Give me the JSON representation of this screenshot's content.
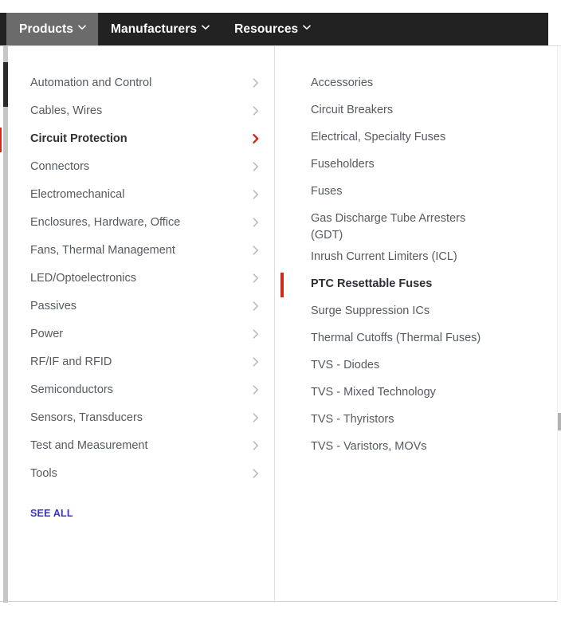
{
  "navbar": {
    "items": [
      {
        "label": "Products",
        "caret": "chevron-down-icon",
        "active": true
      },
      {
        "label": "Manufacturers",
        "caret": "chevron-down-icon",
        "active": false
      },
      {
        "label": "Resources",
        "caret": "chevron-down-icon",
        "active": false
      }
    ]
  },
  "megamenu": {
    "categories": {
      "items": [
        {
          "label": "Automation and Control",
          "chevron": "chevron-right-icon",
          "selected": false
        },
        {
          "label": "Cables, Wires",
          "chevron": "chevron-right-icon",
          "selected": false
        },
        {
          "label": "Circuit Protection",
          "chevron": "chevron-right-icon",
          "selected": true
        },
        {
          "label": "Connectors",
          "chevron": "chevron-right-icon",
          "selected": false
        },
        {
          "label": "Electromechanical",
          "chevron": "chevron-right-icon",
          "selected": false
        },
        {
          "label": "Enclosures, Hardware, Office",
          "chevron": "chevron-right-icon",
          "selected": false
        },
        {
          "label": "Fans, Thermal Management",
          "chevron": "chevron-right-icon",
          "selected": false
        },
        {
          "label": "LED/Optoelectronics",
          "chevron": "chevron-right-icon",
          "selected": false
        },
        {
          "label": "Passives",
          "chevron": "chevron-right-icon",
          "selected": false
        },
        {
          "label": "Power",
          "chevron": "chevron-right-icon",
          "selected": false
        },
        {
          "label": "RF/IF and RFID",
          "chevron": "chevron-right-icon",
          "selected": false
        },
        {
          "label": "Semiconductors",
          "chevron": "chevron-right-icon",
          "selected": false
        },
        {
          "label": "Sensors, Transducers",
          "chevron": "chevron-right-icon",
          "selected": false
        },
        {
          "label": "Test and Measurement",
          "chevron": "chevron-right-icon",
          "selected": false
        },
        {
          "label": "Tools",
          "chevron": "chevron-right-icon",
          "selected": false
        }
      ],
      "see_all_label": "SEE ALL"
    },
    "subcategories": {
      "items": [
        {
          "label": "Accessories",
          "selected": false
        },
        {
          "label": "Circuit Breakers",
          "selected": false
        },
        {
          "label": "Electrical, Specialty Fuses",
          "selected": false
        },
        {
          "label": "Fuseholders",
          "selected": false
        },
        {
          "label": "Fuses",
          "selected": false
        },
        {
          "label": "Gas Discharge Tube Arresters\n(GDT)",
          "selected": false
        },
        {
          "label": "Inrush Current Limiters (ICL)",
          "selected": false
        },
        {
          "label": "PTC Resettable Fuses",
          "selected": true
        },
        {
          "label": "Surge Suppression ICs",
          "selected": false
        },
        {
          "label": "Thermal Cutoffs (Thermal Fuses)",
          "selected": false
        },
        {
          "label": "TVS - Diodes",
          "selected": false
        },
        {
          "label": "TVS - Mixed Technology",
          "selected": false
        },
        {
          "label": "TVS - Thyristors",
          "selected": false
        },
        {
          "label": "TVS - Varistors, MOVs",
          "selected": false
        }
      ]
    }
  },
  "colors": {
    "navbar_bg": "#222222",
    "navbar_active_tab_bg": "#6b6b6b",
    "accent_red": "#cc2b1d",
    "link_blue": "#3b32d4",
    "text_gray": "#555a5f",
    "divider": "#e0e0e0"
  }
}
